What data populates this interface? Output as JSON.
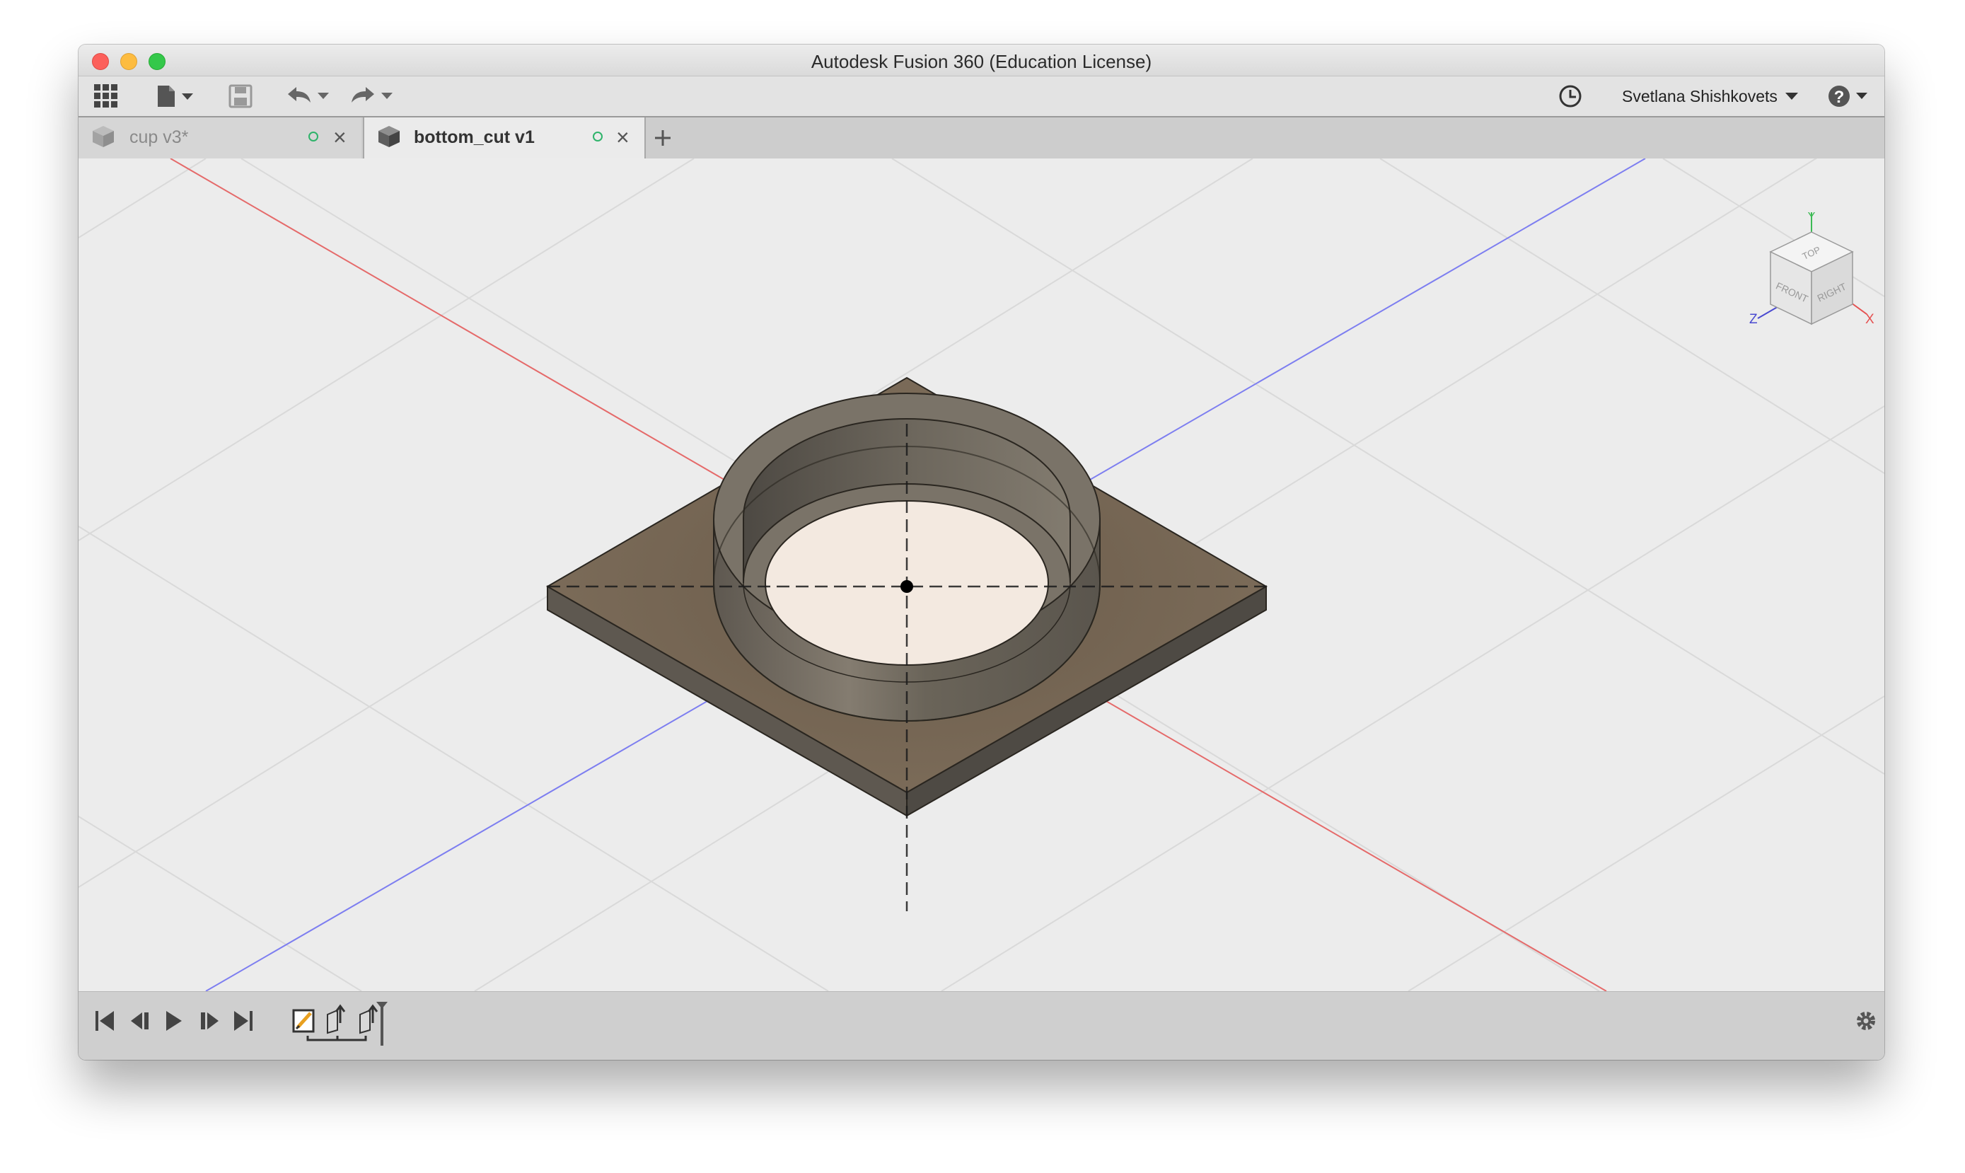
{
  "window": {
    "title": "Autodesk Fusion 360 (Education License)"
  },
  "toolbar": {
    "apps_icon": "grid-icon",
    "file_icon": "document-icon",
    "save_icon": "save-icon",
    "undo_icon": "undo-icon",
    "redo_icon": "redo-icon",
    "history_icon": "clock-icon",
    "user_name": "Svetlana Shishkovets",
    "help_icon": "help-icon"
  },
  "tabs": [
    {
      "label": "cup v3*",
      "active": false
    },
    {
      "label": "bottom_cut v1",
      "active": true
    }
  ],
  "viewcube": {
    "faces": {
      "top": "TOP",
      "front": "FRONT",
      "right": "RIGHT"
    },
    "axes": {
      "y": "Y",
      "z": "Z",
      "x": "X"
    }
  },
  "colors": {
    "x_axis": "#e56a6a",
    "z_axis": "#7d7ef0",
    "body": "#7a6d5c",
    "inner_face": "#f3e9e0",
    "status_green": "#2eb36a"
  },
  "timeline": {
    "controls": [
      "skip-start-icon",
      "step-back-icon",
      "play-icon",
      "step-forward-icon",
      "skip-end-icon"
    ],
    "features": [
      "sketch-feature-icon",
      "extrude-feature-icon",
      "extrude-feature-icon"
    ]
  }
}
